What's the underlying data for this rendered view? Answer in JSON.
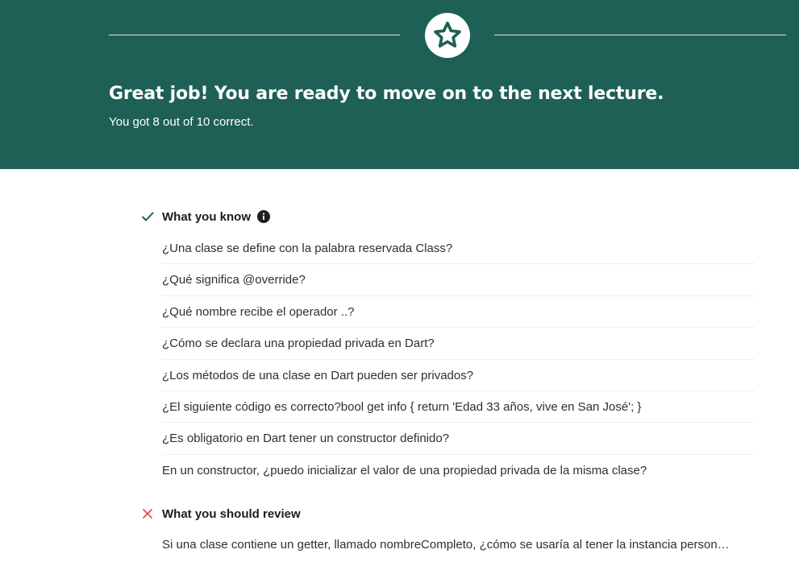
{
  "colors": {
    "hero_bg": "#1e6055",
    "check": "#1e6055",
    "cross": "#d9534f"
  },
  "hero": {
    "icon": "star-icon",
    "title": "Great job! You are ready to move on to the next lecture.",
    "subtitle": "You got 8 out of 10 correct."
  },
  "know": {
    "icon": "check-icon",
    "label": "What you know",
    "info_icon": "info-icon",
    "items": [
      "¿Una clase se define con la palabra reservada Class?",
      "¿Qué significa @override?",
      "¿Qué nombre recibe el operador ..?",
      "¿Cómo se declara una propiedad privada en Dart?",
      "¿Los métodos de una clase en Dart pueden ser privados?",
      "¿El siguiente código es correcto?bool get info { return 'Edad 33 años, vive en San José'; }",
      "¿Es obligatorio en Dart tener un constructor definido?",
      "En un constructor, ¿puedo inicializar el valor de una propiedad privada de la misma clase?"
    ]
  },
  "review": {
    "icon": "close-icon",
    "label": "What you should review",
    "items": [
      "Si una clase contiene un getter, llamado nombreCompleto, ¿cómo se usaría al tener la instancia person…"
    ]
  }
}
